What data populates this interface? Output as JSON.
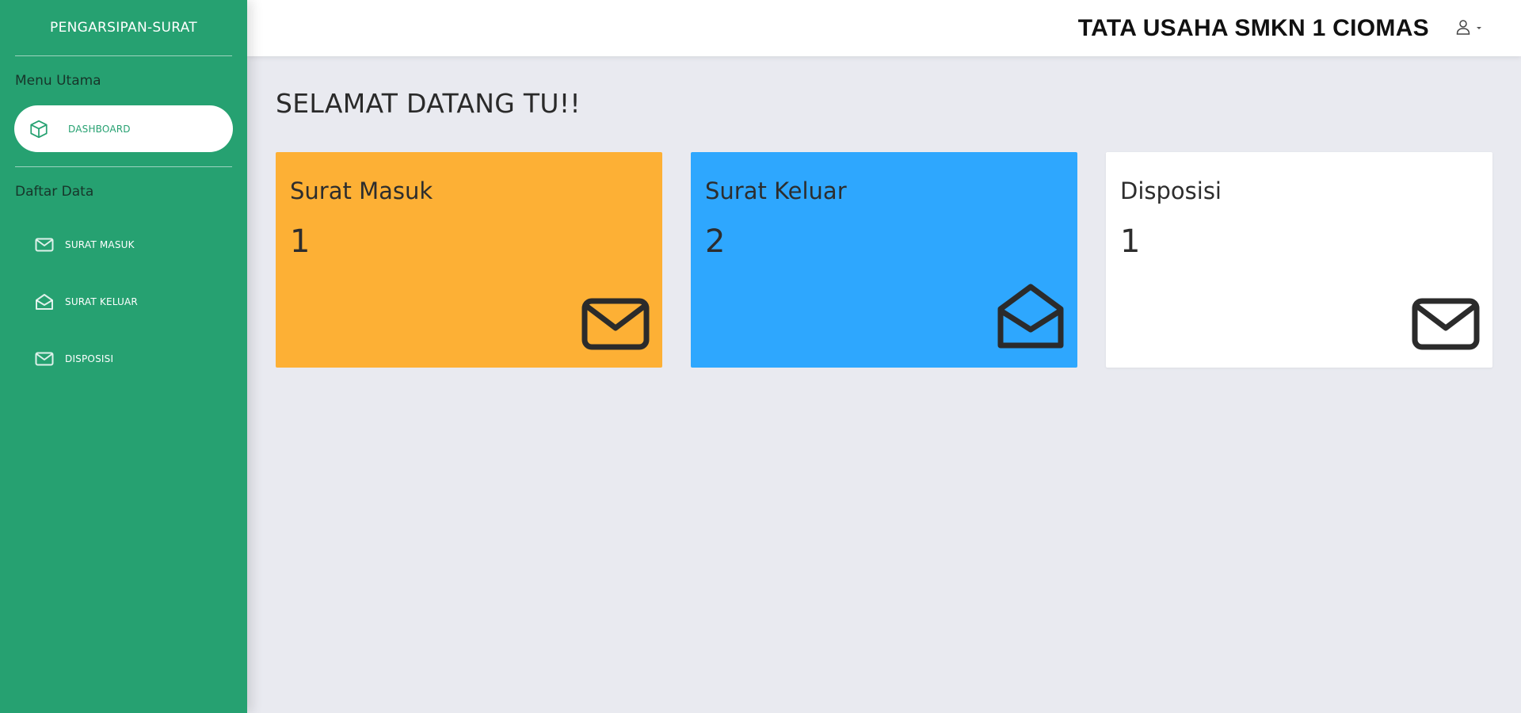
{
  "sidebar": {
    "brand": "PENGARSIPAN-SURAT",
    "section_main": "Menu Utama",
    "active_item": {
      "label": "DASHBOARD",
      "icon": "cube-icon"
    },
    "section_data": "Daftar Data",
    "items": [
      {
        "label": "SURAT MASUK",
        "icon": "envelope-icon"
      },
      {
        "label": "SURAT KELUAR",
        "icon": "envelope-open-icon"
      },
      {
        "label": "DISPOSISI",
        "icon": "envelope-icon"
      }
    ]
  },
  "header": {
    "title": "TATA USAHA SMKN 1 CIOMAS",
    "user_icon": "user-icon"
  },
  "main": {
    "welcome": "SELAMAT DATANG TU!!",
    "cards": [
      {
        "title": "Surat Masuk",
        "count": "1",
        "color": "#fdb035",
        "icon": "envelope-icon"
      },
      {
        "title": "Surat Keluar",
        "count": "2",
        "color": "#2ea7fe",
        "icon": "envelope-open-icon"
      },
      {
        "title": "Disposisi",
        "count": "1",
        "color": "#ffffff",
        "icon": "envelope-icon"
      }
    ]
  },
  "colors": {
    "sidebar_bg": "#26a171",
    "page_bg": "#e9eaf0",
    "accent": "#26a171"
  }
}
